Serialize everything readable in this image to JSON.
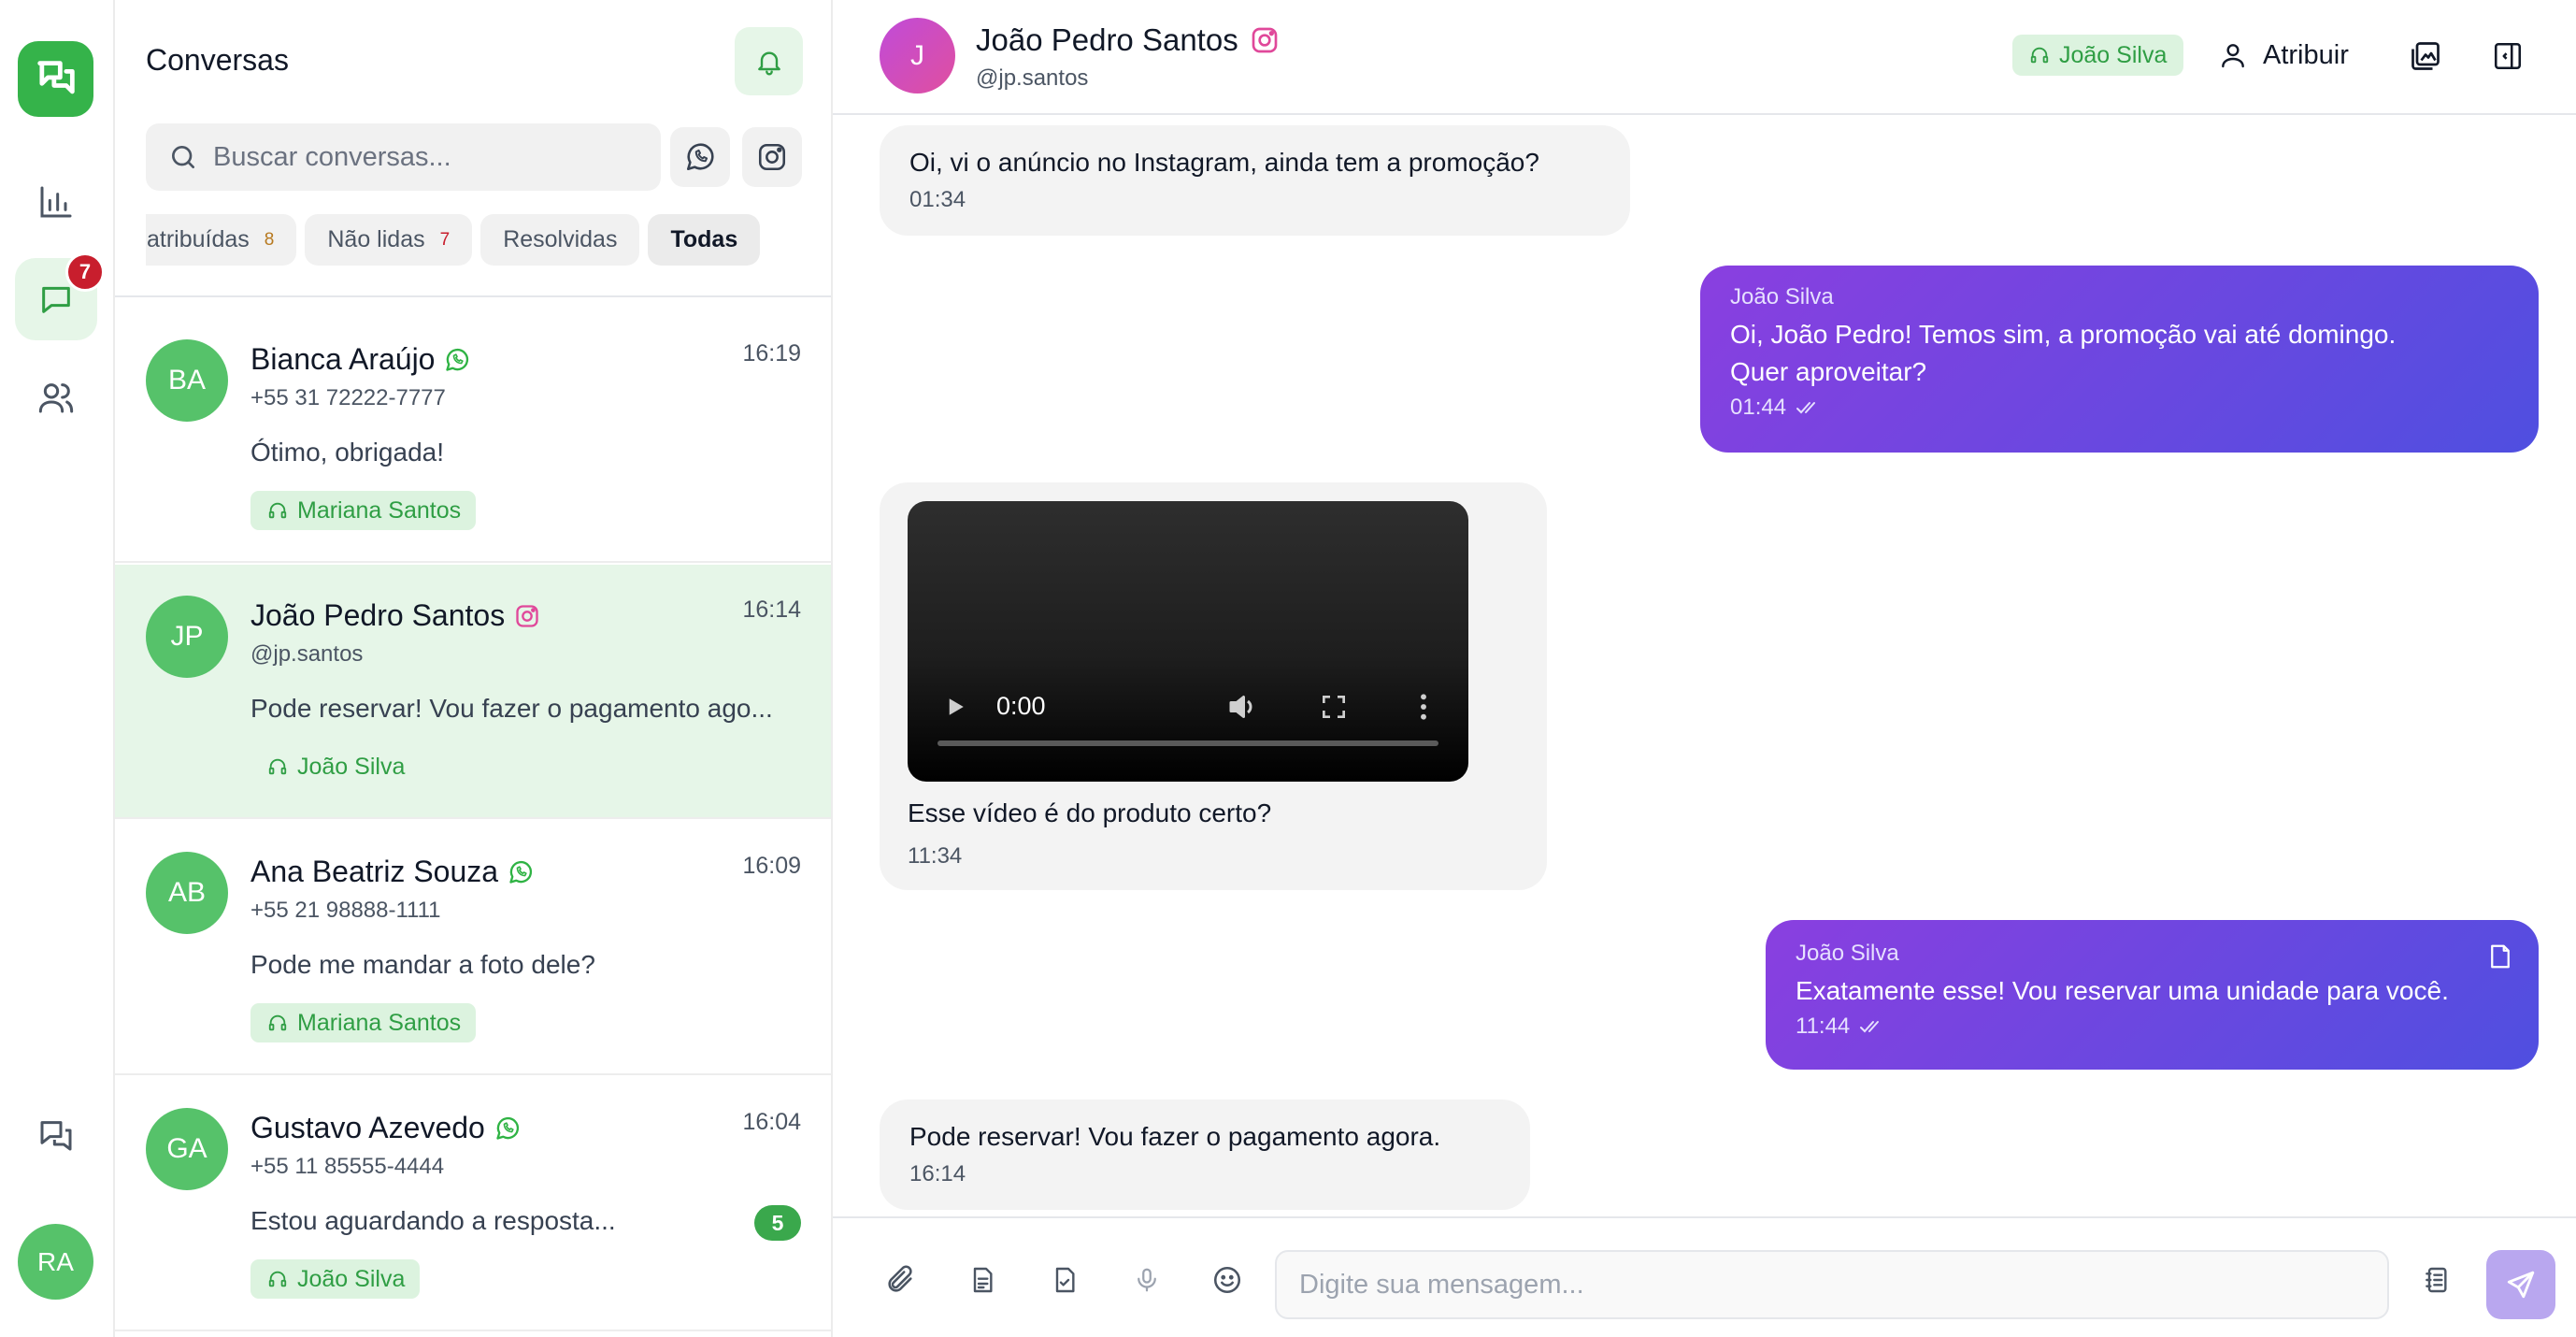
{
  "rail": {
    "chat_badge": "7",
    "user_initials": "RA",
    "accent": "#35b34a"
  },
  "list": {
    "title": "Conversas",
    "search_placeholder": "Buscar conversas...",
    "filters": [
      {
        "label": "atribuídas",
        "count": "8"
      },
      {
        "label": "Não lidas",
        "count": "7"
      },
      {
        "label": "Resolvidas"
      },
      {
        "label": "Todas"
      }
    ],
    "conversations": [
      {
        "initials": "BA",
        "name": "Bianca Araújo",
        "channel": "whatsapp",
        "handle": "+55 31 72222-7777",
        "time": "16:19",
        "message": "Ótimo, obrigada!",
        "agent": "Mariana Santos"
      },
      {
        "initials": "JP",
        "name": "João Pedro Santos",
        "channel": "instagram",
        "handle": "@jp.santos",
        "time": "16:14",
        "message": "Pode reservar! Vou fazer o pagamento ago...",
        "agent": "João Silva"
      },
      {
        "initials": "AB",
        "name": "Ana Beatriz Souza",
        "channel": "whatsapp",
        "handle": "+55 21 98888-1111",
        "time": "16:09",
        "message": "Pode me mandar a foto dele?",
        "agent": "Mariana Santos"
      },
      {
        "initials": "GA",
        "name": "Gustavo Azevedo",
        "channel": "whatsapp",
        "handle": "+55 11 85555-4444",
        "time": "16:04",
        "message": "Estou aguardando a resposta...",
        "agent": "João Silva",
        "unread": "5"
      }
    ]
  },
  "chat": {
    "contact_initial": "J",
    "contact_name": "João Pedro Santos",
    "contact_handle": "@jp.santos",
    "agent": "João Silva",
    "assign_label": "Atribuir",
    "messages": [
      {
        "text": "Oi, vi o anúncio no Instagram, ainda tem a promoção?",
        "time": "01:34"
      },
      {
        "author": "João Silva",
        "text1": "Oi, João Pedro! Temos sim, a promoção vai até domingo.",
        "text2": "Quer aproveitar?",
        "time": "01:44"
      },
      {
        "video_time": "0:00",
        "text": "Esse vídeo é do produto certo?",
        "time": "11:34"
      },
      {
        "author": "João Silva",
        "text": "Exatamente esse! Vou reservar uma unidade para você.",
        "time": "11:44"
      },
      {
        "text": "Pode reservar! Vou fazer o pagamento agora.",
        "time": "16:14"
      }
    ],
    "composer_placeholder": "Digite sua mensagem..."
  },
  "colors": {
    "whatsapp": "#2fb344",
    "instagram": "#e0489a",
    "outgoing_start": "#8a3fe0",
    "outgoing_end": "#4f4fe0"
  }
}
